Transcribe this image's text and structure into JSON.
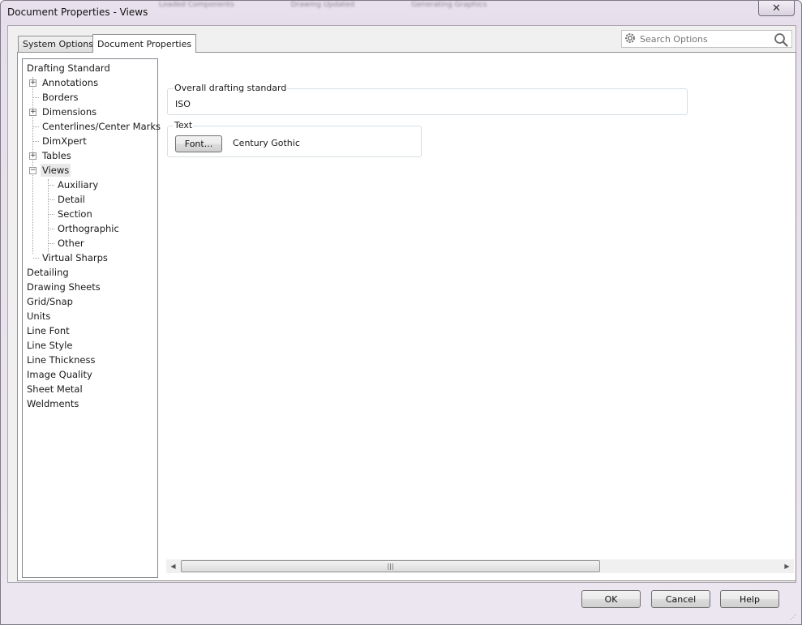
{
  "window": {
    "title": "Document Properties - Views",
    "background_labels": [
      "Loaded Components",
      "Drawing Updated",
      "Generating Graphics"
    ]
  },
  "tabs": [
    {
      "label": "System Options",
      "active": false
    },
    {
      "label": "Document Properties",
      "active": true
    }
  ],
  "search": {
    "placeholder": "Search Options",
    "icon": "gear-icon"
  },
  "tree": {
    "items": [
      {
        "label": "Drafting Standard",
        "level": 0
      },
      {
        "label": "Annotations",
        "level": 1,
        "expander": "plus"
      },
      {
        "label": "Borders",
        "level": 1
      },
      {
        "label": "Dimensions",
        "level": 1,
        "expander": "plus"
      },
      {
        "label": "Centerlines/Center Marks",
        "level": 1
      },
      {
        "label": "DimXpert",
        "level": 1
      },
      {
        "label": "Tables",
        "level": 1,
        "expander": "plus"
      },
      {
        "label": "Views",
        "level": 1,
        "expander": "minus",
        "selected": true
      },
      {
        "label": "Auxiliary",
        "level": 2
      },
      {
        "label": "Detail",
        "level": 2
      },
      {
        "label": "Section",
        "level": 2
      },
      {
        "label": "Orthographic",
        "level": 2
      },
      {
        "label": "Other",
        "level": 2
      },
      {
        "label": "Virtual Sharps",
        "level": 1
      },
      {
        "label": "Detailing",
        "level": 0
      },
      {
        "label": "Drawing Sheets",
        "level": 0
      },
      {
        "label": "Grid/Snap",
        "level": 0
      },
      {
        "label": "Units",
        "level": 0
      },
      {
        "label": "Line Font",
        "level": 0
      },
      {
        "label": "Line Style",
        "level": 0
      },
      {
        "label": "Line Thickness",
        "level": 0
      },
      {
        "label": "Image Quality",
        "level": 0
      },
      {
        "label": "Sheet Metal",
        "level": 0
      },
      {
        "label": "Weldments",
        "level": 0
      }
    ]
  },
  "content": {
    "drafting_group_title": "Overall drafting standard",
    "drafting_value": "ISO",
    "text_group_title": "Text",
    "font_button": "Font...",
    "font_value": "Century Gothic"
  },
  "footer": {
    "ok": "OK",
    "cancel": "Cancel",
    "help": "Help"
  },
  "colors": {
    "selected_text_bg": "#e8e8e8"
  }
}
